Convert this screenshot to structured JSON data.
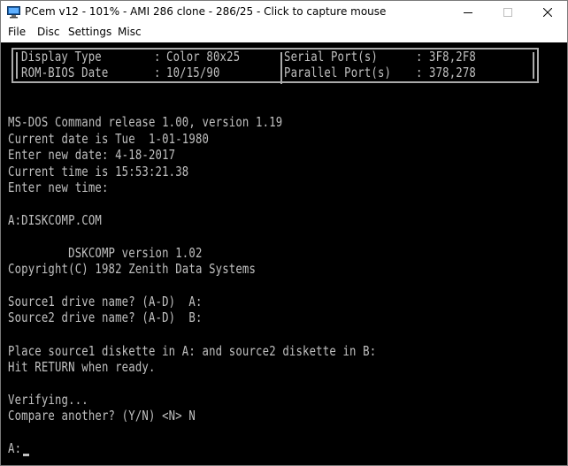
{
  "window": {
    "title": "PCem v12 - 101% - AMI 286 clone - 286/25 - Click to capture mouse",
    "controls": {
      "minimize": "minimize-icon",
      "maximize": "maximize-icon",
      "close": "close-icon"
    }
  },
  "menu": {
    "file": "File",
    "disc": "Disc",
    "settings": "Settings",
    "misc": "Misc"
  },
  "bios_table": {
    "display_type_label": "Display Type",
    "display_type_value": "Color 80x25",
    "rom_bios_date_label": "ROM-BIOS Date",
    "rom_bios_date_value": "10/15/90",
    "serial_ports_label": "Serial Port(s)",
    "serial_ports_value": "3F8,2F8",
    "parallel_ports_label": "Parallel Port(s)",
    "parallel_ports_value": "378,278"
  },
  "console": {
    "line1": "MS-DOS Command release 1.00, version 1.19",
    "line2": "Current date is Tue  1-01-1980",
    "line3": "Enter new date: 4-18-2017",
    "line4": "Current time is 15:53:21.38",
    "line5": "Enter new time:",
    "line6": "A:DISKCOMP.COM",
    "line7": "         DSKCOMP version 1.02",
    "line8": "Copyright(C) 1982 Zenith Data Systems",
    "line9": "Source1 drive name? (A-D)  A:",
    "line10": "Source2 drive name? (A-D)  B:",
    "line11": "Place source1 diskette in A: and source2 diskette in B:",
    "line12": "Hit RETURN when ready.",
    "line13": "Verifying...",
    "line14": "Compare another? (Y/N) <N> N",
    "prompt": "A:"
  },
  "colors": {
    "console_bg": "#000000",
    "console_fg": "#c0c0c0",
    "window_bg": "#ffffff"
  }
}
